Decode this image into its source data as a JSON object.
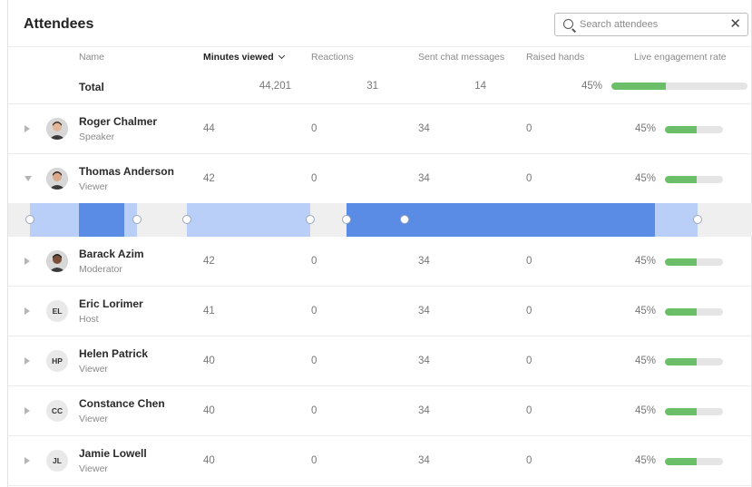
{
  "header": {
    "title": "Attendees",
    "search_placeholder": "Search attendees",
    "clear_label": "✕"
  },
  "columns": {
    "name": "Name",
    "minutes_viewed": "Minutes viewed",
    "reactions": "Reactions",
    "sent_chat_messages": "Sent chat messages",
    "raised_hands": "Raised hands",
    "live_engagement_rate": "Live engagement rate",
    "sorted_by": "minutes_viewed"
  },
  "total": {
    "label": "Total",
    "minutes_viewed": "44,201",
    "reactions": "31",
    "sent_chat_messages": "14",
    "engagement_pct": "45%",
    "engagement_fraction": 0.4
  },
  "attendees": [
    {
      "name": "Roger Chalmer",
      "role": "Speaker",
      "avatar": "photo",
      "minutes": "44",
      "reactions": "0",
      "chat": "34",
      "raised": "0",
      "engagement_pct": "45%",
      "engagement_fraction": 0.55,
      "expanded": false
    },
    {
      "name": "Thomas Anderson",
      "role": "Viewer",
      "avatar": "photo",
      "minutes": "42",
      "reactions": "0",
      "chat": "34",
      "raised": "0",
      "engagement_pct": "45%",
      "engagement_fraction": 0.55,
      "expanded": true
    },
    {
      "name": "Barack Azim",
      "role": "Moderator",
      "avatar": "photo",
      "minutes": "42",
      "reactions": "0",
      "chat": "34",
      "raised": "0",
      "engagement_pct": "45%",
      "engagement_fraction": 0.55,
      "expanded": false
    },
    {
      "name": "Eric Lorimer",
      "role": "Host",
      "avatar": "EL",
      "minutes": "41",
      "reactions": "0",
      "chat": "34",
      "raised": "0",
      "engagement_pct": "45%",
      "engagement_fraction": 0.55,
      "expanded": false
    },
    {
      "name": "Helen Patrick",
      "role": "Viewer",
      "avatar": "HP",
      "minutes": "40",
      "reactions": "0",
      "chat": "34",
      "raised": "0",
      "engagement_pct": "45%",
      "engagement_fraction": 0.55,
      "expanded": false
    },
    {
      "name": "Constance Chen",
      "role": "Viewer",
      "avatar": "CC",
      "minutes": "40",
      "reactions": "0",
      "chat": "34",
      "raised": "0",
      "engagement_pct": "45%",
      "engagement_fraction": 0.55,
      "expanded": false
    },
    {
      "name": "Jamie Lowell",
      "role": "Viewer",
      "avatar": "JL",
      "minutes": "40",
      "reactions": "0",
      "chat": "34",
      "raised": "0",
      "engagement_pct": "45%",
      "engagement_fraction": 0.55,
      "expanded": false
    }
  ],
  "colors": {
    "engagement_fill": "#6bbf68",
    "timeline_light": "#b9cff7",
    "timeline_dark": "#5b8ce5",
    "timeline_bg": "#efefef"
  }
}
